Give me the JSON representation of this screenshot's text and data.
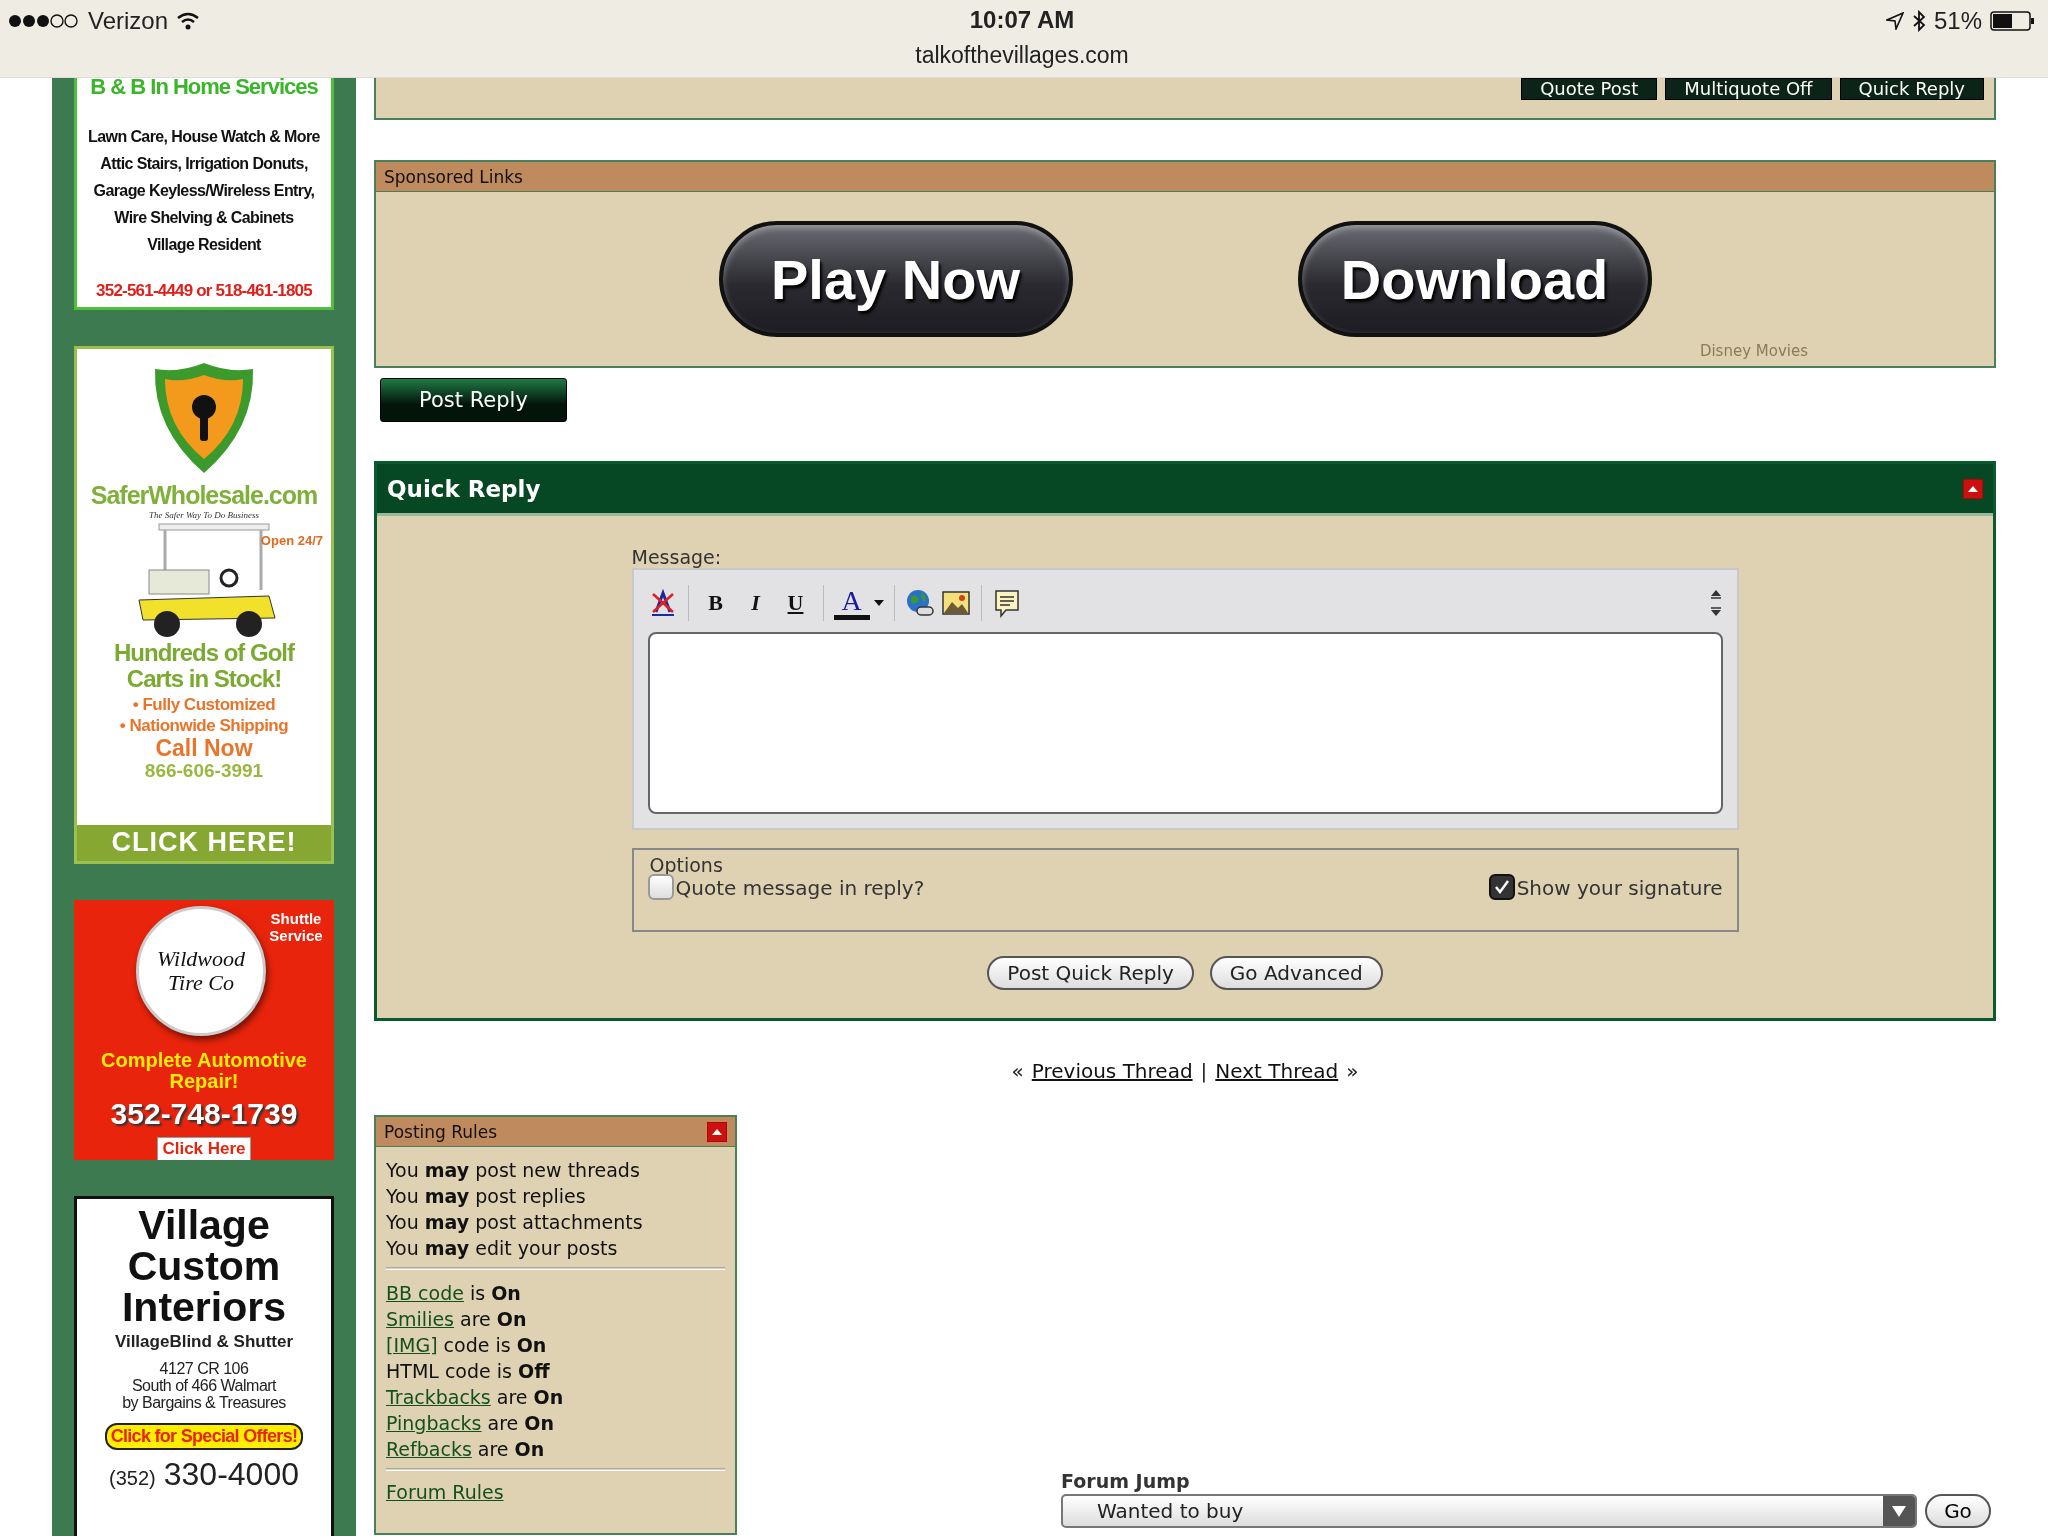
{
  "status_bar": {
    "carrier": "Verizon",
    "time": "10:07 AM",
    "url": "talkofthevillages.com",
    "battery": "51%"
  },
  "sidebar_ads": [
    {
      "kind": "services",
      "title": "B & B In Home Services",
      "lines": [
        "Lawn Care, House Watch & More",
        "Attic Stairs, Irrigation Donuts,",
        "Garage Keyless/Wireless Entry,",
        "Wire Shelving & Cabinets",
        "Village Resident"
      ],
      "phone": "352-561-4449 or 518-461-1805"
    },
    {
      "kind": "golf",
      "brand": "SaferWholesale.com",
      "tagline": "The Safer Way To Do Business",
      "badge": "Open 24/7",
      "headline": "Hundreds of Golf Carts in Stock!",
      "bullets": [
        "• Fully Customized",
        "• Nationwide Shipping"
      ],
      "call": "Call Now",
      "phone": "866-606-3991",
      "cta": "CLICK HERE!"
    },
    {
      "kind": "tire",
      "badge": "Shuttle Service",
      "logo": "Wildwood Tire Co",
      "headline": "Complete Automotive Repair!",
      "phone": "352-748-1739",
      "cta": "Click Here"
    },
    {
      "kind": "interiors",
      "title": "Village Custom Interiors",
      "subtitle": "VillageBlind & Shutter",
      "address": [
        "4127 CR 106",
        "South of 466 Walmart",
        "by Bargains & Treasures"
      ],
      "cta": "Click for Special Offers!",
      "area_code": "(352)",
      "phone": "330-4000"
    }
  ],
  "post_buttons": [
    "Quote Post",
    "Multiquote Off",
    "Quick Reply"
  ],
  "sponsored": {
    "title": "Sponsored Links",
    "buttons": [
      "Play Now",
      "Download"
    ],
    "caption": "Disney Movies"
  },
  "post_reply_button": "Post Reply",
  "quick_reply": {
    "title": "Quick Reply",
    "message_label": "Message:",
    "format_buttons": [
      "B",
      "I",
      "U"
    ],
    "font_color_button": "A",
    "options": {
      "legend": "Options",
      "checkboxes": [
        {
          "label": "Quote message in reply?",
          "checked": false
        },
        {
          "label": "Show your signature",
          "checked": true
        }
      ]
    },
    "buttons": [
      "Post Quick Reply",
      "Go Advanced"
    ]
  },
  "thread_nav": {
    "prefix": "«",
    "previous": "Previous Thread",
    "separator": "|",
    "next": "Next Thread",
    "suffix": "»"
  },
  "posting_rules": {
    "title": "Posting Rules",
    "permissions": [
      "You **may** post new threads",
      "You **may** post replies",
      "You **may** post attachments",
      "You **may** edit your posts"
    ],
    "settings": [
      {
        "link": "BB code",
        "text": "is **On**"
      },
      {
        "link": "Smilies",
        "text": "are **On**"
      },
      {
        "link": "[IMG]",
        "text": "code is **On**"
      },
      {
        "text": "HTML code is **Off**"
      },
      {
        "link": "Trackbacks",
        "text": "are **On**"
      },
      {
        "link": "Pingbacks",
        "text": "are **On**"
      },
      {
        "link": "Refbacks",
        "text": "are **On**"
      }
    ],
    "footer_link": "Forum Rules"
  },
  "forum_jump": {
    "label": "Forum Jump",
    "selected": "Wanted to buy",
    "button": "Go"
  }
}
